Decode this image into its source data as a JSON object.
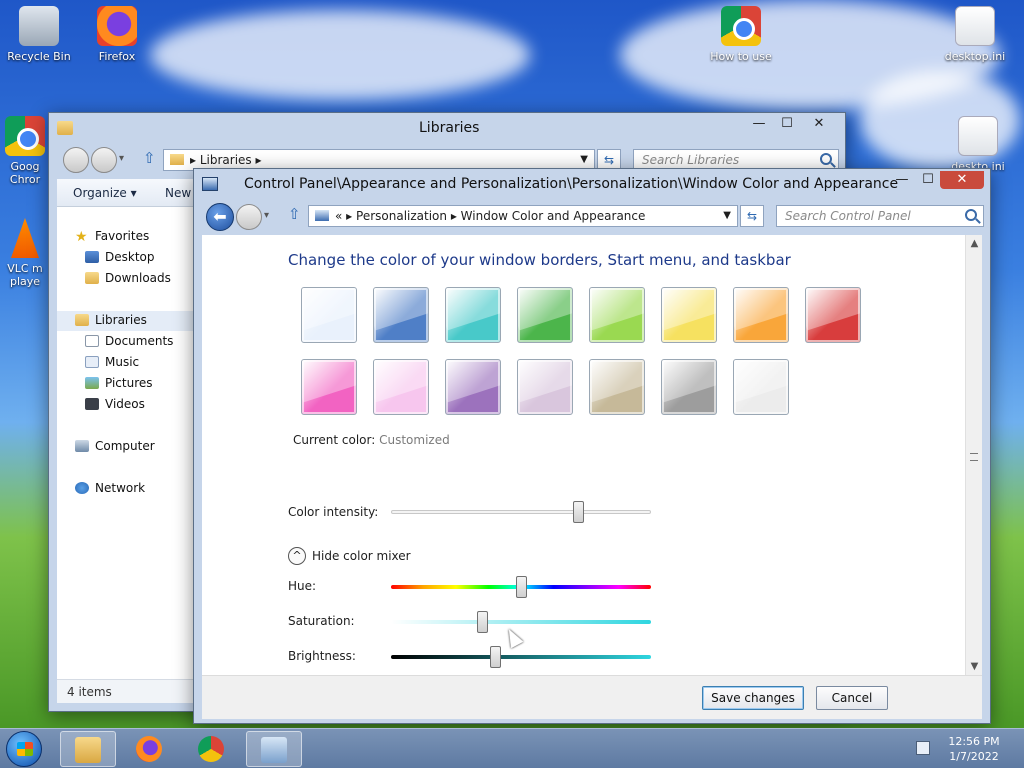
{
  "desktop": {
    "icons": [
      {
        "label": "Recycle Bin",
        "icon": "recycle-bin-icon"
      },
      {
        "label": "Firefox",
        "icon": "firefox-icon"
      },
      {
        "label": "How to use",
        "icon": "chrome-icon"
      },
      {
        "label": "desktop.ini",
        "icon": "settings-file-icon"
      },
      {
        "label": "Goog Chror",
        "icon": "chrome-icon"
      },
      {
        "label": "VLC m playe",
        "icon": "vlc-icon"
      },
      {
        "label": "deskto ini",
        "icon": "settings-file-icon"
      }
    ]
  },
  "libraries": {
    "title": "Libraries",
    "breadcrumb": "Libraries",
    "search_placeholder": "Search Libraries",
    "toolbar": {
      "organize": "Organize",
      "new": "New"
    },
    "nav": {
      "favorites": "Favorites",
      "desktop": "Desktop",
      "downloads": "Downloads",
      "libraries": "Libraries",
      "documents": "Documents",
      "music": "Music",
      "pictures": "Pictures",
      "videos": "Videos",
      "computer": "Computer",
      "network": "Network"
    },
    "status": "4 items"
  },
  "control_panel": {
    "title": "Control Panel\\Appearance and Personalization\\Personalization\\Window Color and Appearance",
    "breadcrumb": {
      "prefix": "«",
      "item1": "Personalization",
      "item2": "Window Color and Appearance"
    },
    "search_placeholder": "Search Control Panel",
    "heading": "Change the color of your window borders, Start menu, and taskbar",
    "swatch_colors": [
      [
        "#e9f1fc",
        "#4f7fc7",
        "#48c9c9",
        "#4cb54b",
        "#9ad951",
        "#f6e160",
        "#f9a63a",
        "#d83d3d"
      ],
      [
        "#f263c2",
        "#f7c6ee",
        "#9c72bd",
        "#d9c6dd",
        "#c6b999",
        "#9d9d9d",
        "#ececec"
      ]
    ],
    "current_color_label": "Current color:",
    "current_color_value": "Customized",
    "intensity_label": "Color intensity:",
    "intensity": 0.72,
    "mixer_toggle": "Hide color mixer",
    "hue_label": "Hue:",
    "hue": 0.5,
    "saturation_label": "Saturation:",
    "saturation": 0.35,
    "brightness_label": "Brightness:",
    "brightness": 0.4,
    "save_label": "Save changes",
    "cancel_label": "Cancel"
  },
  "taskbar": {
    "time": "12:56 PM",
    "date": "1/7/2022"
  }
}
